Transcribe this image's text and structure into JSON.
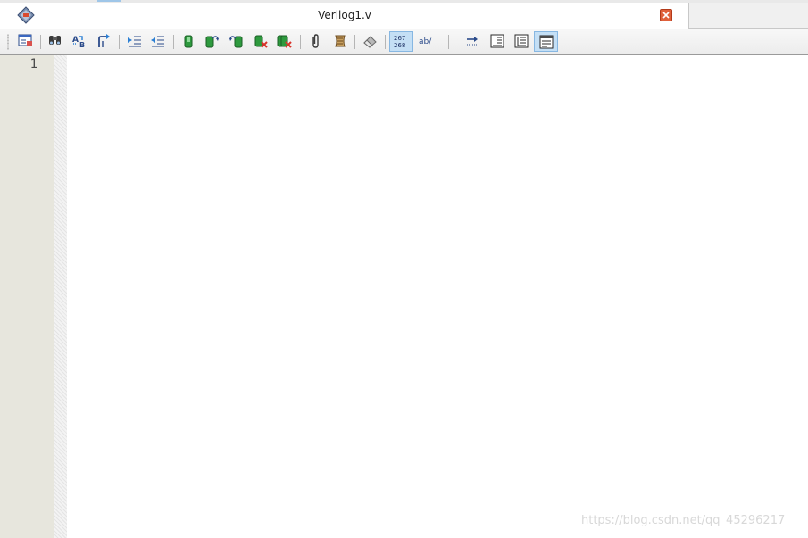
{
  "document": {
    "title": "Verilog1.v"
  },
  "toolbar": {
    "buttons": [
      {
        "name": "template-insert-icon",
        "active": false
      },
      {
        "name": "find-icon",
        "active": false
      },
      {
        "name": "replace-icon",
        "active": false
      },
      {
        "name": "goto-icon",
        "active": false
      },
      {
        "name": "indent-icon",
        "active": false
      },
      {
        "name": "unindent-icon",
        "active": false
      },
      {
        "name": "toggle-bookmark-icon",
        "active": false
      },
      {
        "name": "next-bookmark-icon",
        "active": false
      },
      {
        "name": "previous-bookmark-icon",
        "active": false
      },
      {
        "name": "clear-bookmark-icon",
        "active": false
      },
      {
        "name": "clear-all-bookmarks-icon",
        "active": false
      },
      {
        "name": "paperclip-icon",
        "active": false
      },
      {
        "name": "comment-icon",
        "active": false
      },
      {
        "name": "eraser-icon",
        "active": false
      },
      {
        "name": "line-numbers-icon",
        "active": true,
        "text": [
          "267",
          "268"
        ]
      },
      {
        "name": "spell-check-icon",
        "active": false,
        "text": "ab/"
      },
      {
        "name": "word-wrap-icon",
        "active": false
      },
      {
        "name": "show-whitespace-icon",
        "active": false
      },
      {
        "name": "block-view-icon",
        "active": false
      },
      {
        "name": "split-view-icon",
        "active": false
      }
    ]
  },
  "editor": {
    "line_numbers": [
      "1"
    ],
    "content": ""
  },
  "watermark": "https://blog.csdn.net/qq_45296217",
  "colors": {
    "gutter": "#e7e6dd",
    "active_button": "#c4dff5",
    "close_button": "#e0613b"
  }
}
